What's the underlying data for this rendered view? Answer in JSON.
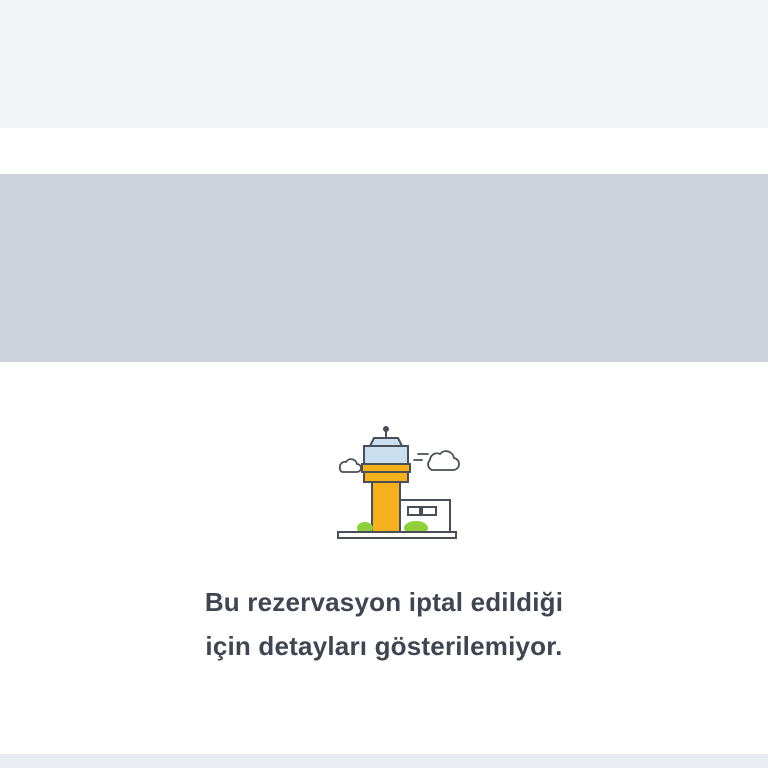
{
  "message": {
    "line1": "Bu rezervasyon iptal edildiği",
    "line2": "için detayları gösterilemiyor."
  },
  "illustration": {
    "icon": "control-tower-icon",
    "colors": {
      "tower": "#f5b01e",
      "glass": "#c9dff0",
      "outline": "#4a4f57",
      "grass": "#8fcf3c"
    }
  },
  "colors": {
    "top_band": "#f1f4f7",
    "gray_panel": "#cdd2db",
    "text": "#3f4651",
    "bottom_band": "#e9edf2"
  }
}
